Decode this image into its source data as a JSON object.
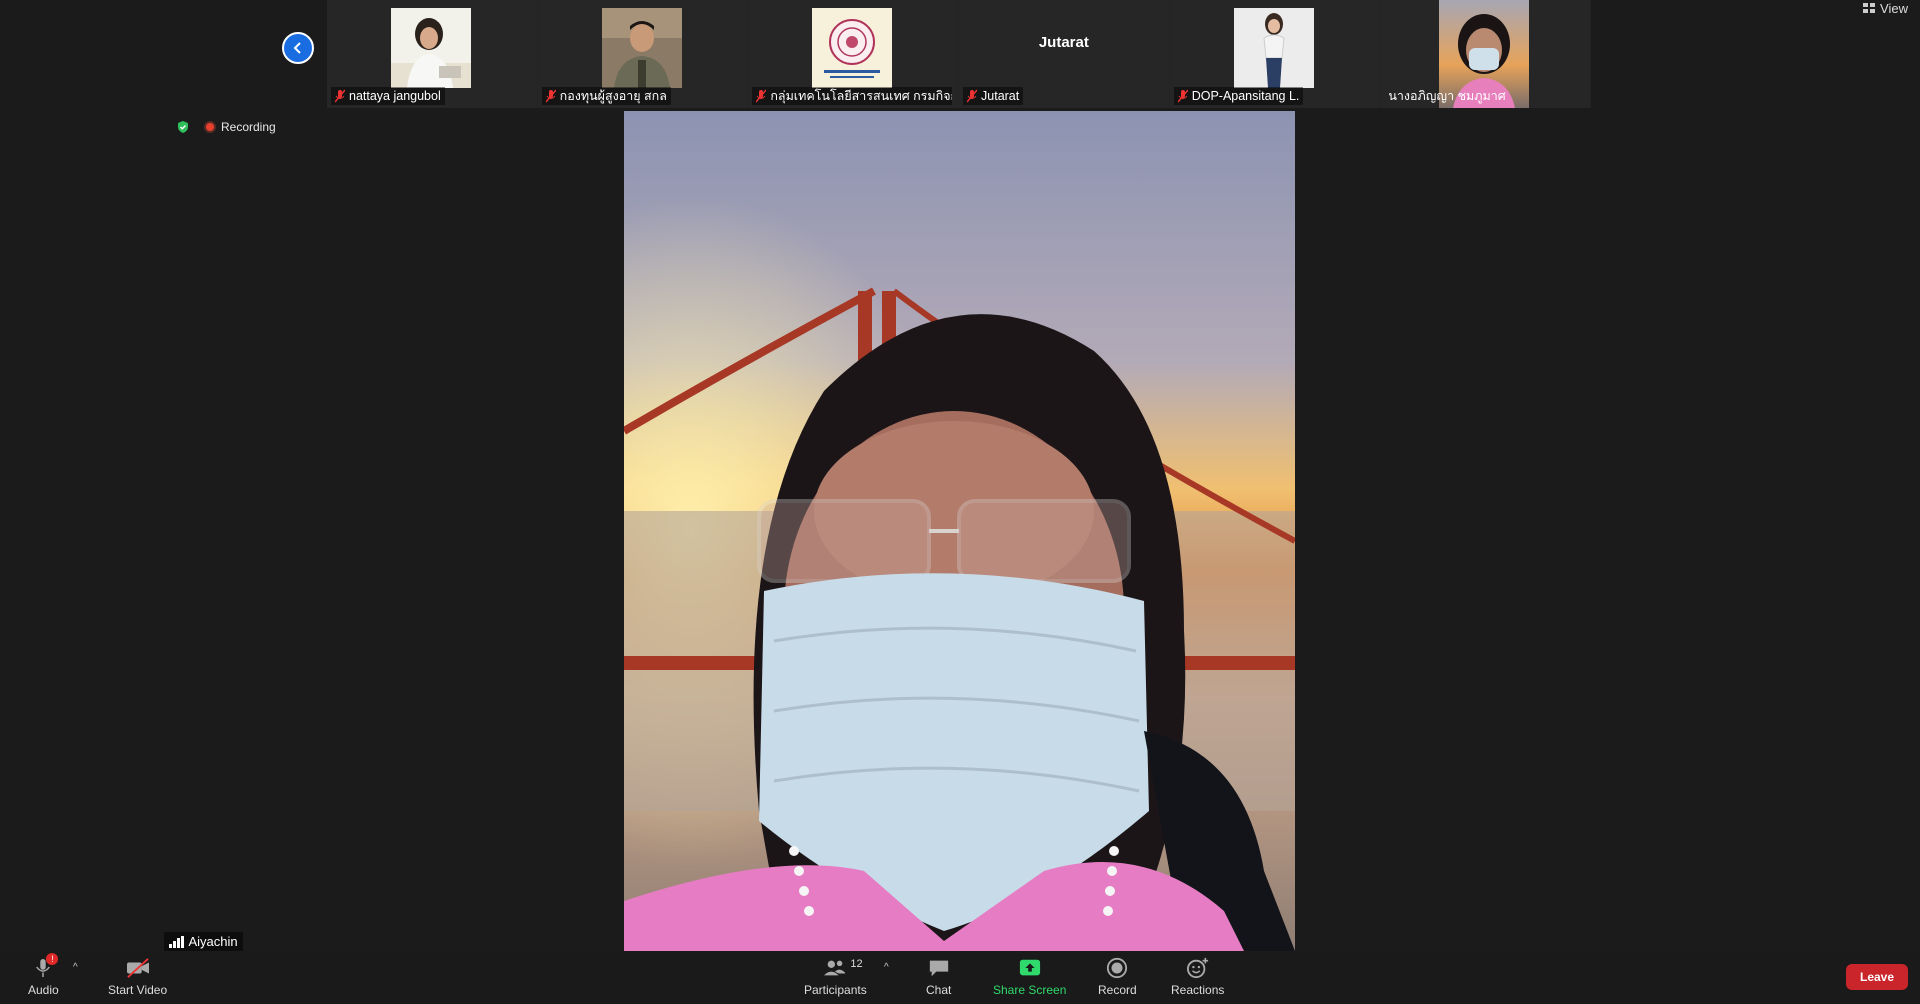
{
  "top": {
    "view_label": "View"
  },
  "participants_strip": [
    {
      "name": "nattaya jangubol",
      "has_video": true
    },
    {
      "name": "กองทุนผู้สูงอายุ สกล",
      "has_video": true
    },
    {
      "name": "กลุ่มเทคโนโลยีสารสนเทศ กรมกิจกา...",
      "has_video": true
    },
    {
      "name": "Jutarat",
      "has_video": false,
      "display_text": "Jutarat"
    },
    {
      "name": "DOP-Apansitang L.",
      "has_video": true
    },
    {
      "name": "นางอภิญญา ชมภูมาศ",
      "has_video": true
    }
  ],
  "status": {
    "recording_label": "Recording"
  },
  "main_speaker": {
    "name": "Aiyachin"
  },
  "toolbar": {
    "audio_label": "Audio",
    "audio_badge": "!",
    "start_video_label": "Start Video",
    "participants_label": "Participants",
    "participants_count": "12",
    "chat_label": "Chat",
    "share_screen_label": "Share Screen",
    "record_label": "Record",
    "reactions_label": "Reactions",
    "leave_label": "Leave"
  },
  "colors": {
    "accent_blue": "#1a6de0",
    "share_green": "#2fd96b",
    "leave_red": "#c9252b",
    "rec_red": "#e8402e"
  }
}
